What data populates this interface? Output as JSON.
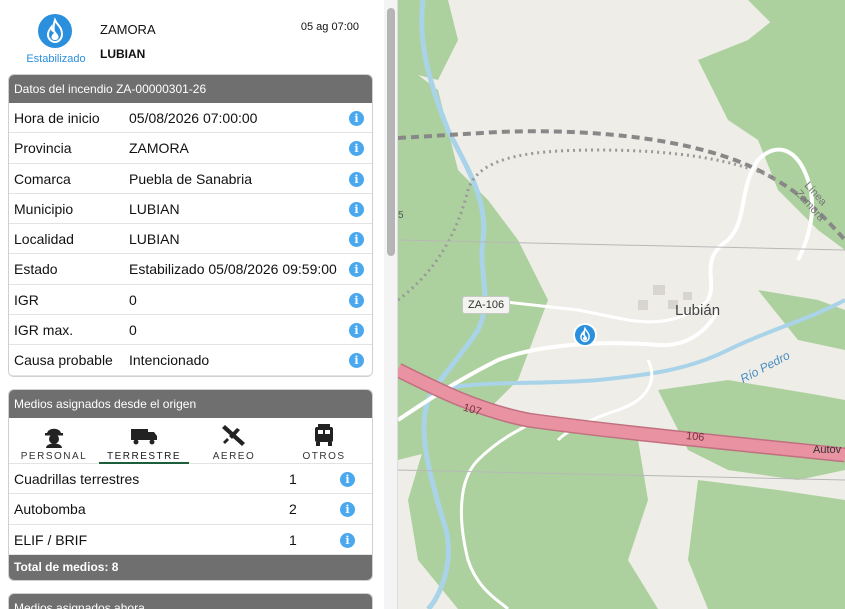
{
  "header": {
    "status_label": "Estabilizado",
    "provincia": "ZAMORA",
    "localidad": "LUBIAN",
    "fecha": "05 ag 07:00",
    "status_color": "#2a8fdc"
  },
  "datos": {
    "title": "Datos del incendio ZA-00000301-26",
    "rows": [
      {
        "k": "Hora de inicio",
        "v": "05/08/2026 07:00:00"
      },
      {
        "k": "Provincia",
        "v": "ZAMORA"
      },
      {
        "k": "Comarca",
        "v": "Puebla de Sanabria"
      },
      {
        "k": "Municipio",
        "v": "LUBIAN"
      },
      {
        "k": "Localidad",
        "v": "LUBIAN"
      },
      {
        "k": "Estado",
        "v": "Estabilizado 05/08/2026 09:59:00"
      },
      {
        "k": "IGR",
        "v": "0"
      },
      {
        "k": "IGR max.",
        "v": "0"
      },
      {
        "k": "Causa probable",
        "v": "Intencionado"
      }
    ],
    "info_glyph": "i"
  },
  "medios_origen": {
    "title": "Medios asignados desde el origen",
    "tabs": [
      {
        "label": "PERSONAL",
        "icon": "personal-icon",
        "active": false
      },
      {
        "label": "TERRESTRE",
        "icon": "truck-icon",
        "active": true
      },
      {
        "label": "AEREO",
        "icon": "airplane-icon",
        "active": false
      },
      {
        "label": "OTROS",
        "icon": "fire-truck-icon",
        "active": false
      }
    ],
    "rows": [
      {
        "k": "Cuadrillas terrestres",
        "n": "1"
      },
      {
        "k": "Autobomba",
        "n": "2"
      },
      {
        "k": "ELIF / BRIF",
        "n": "1"
      }
    ],
    "total": "Total de medios: 8"
  },
  "medios_ahora": {
    "title": "Medios asignados ahora"
  },
  "map": {
    "labels": {
      "road_za106": "ZA-106",
      "town": "Lubián",
      "river": "Río Pedro",
      "rail": "Línea Zamora",
      "motorway_107": "107",
      "motorway_106": "106",
      "autov": "Autov",
      "edge_number": "5"
    },
    "colors": {
      "forest": "#add19e",
      "water": "#a9d3e8",
      "motorway": "#e892a2",
      "background": "#eeede8"
    }
  }
}
